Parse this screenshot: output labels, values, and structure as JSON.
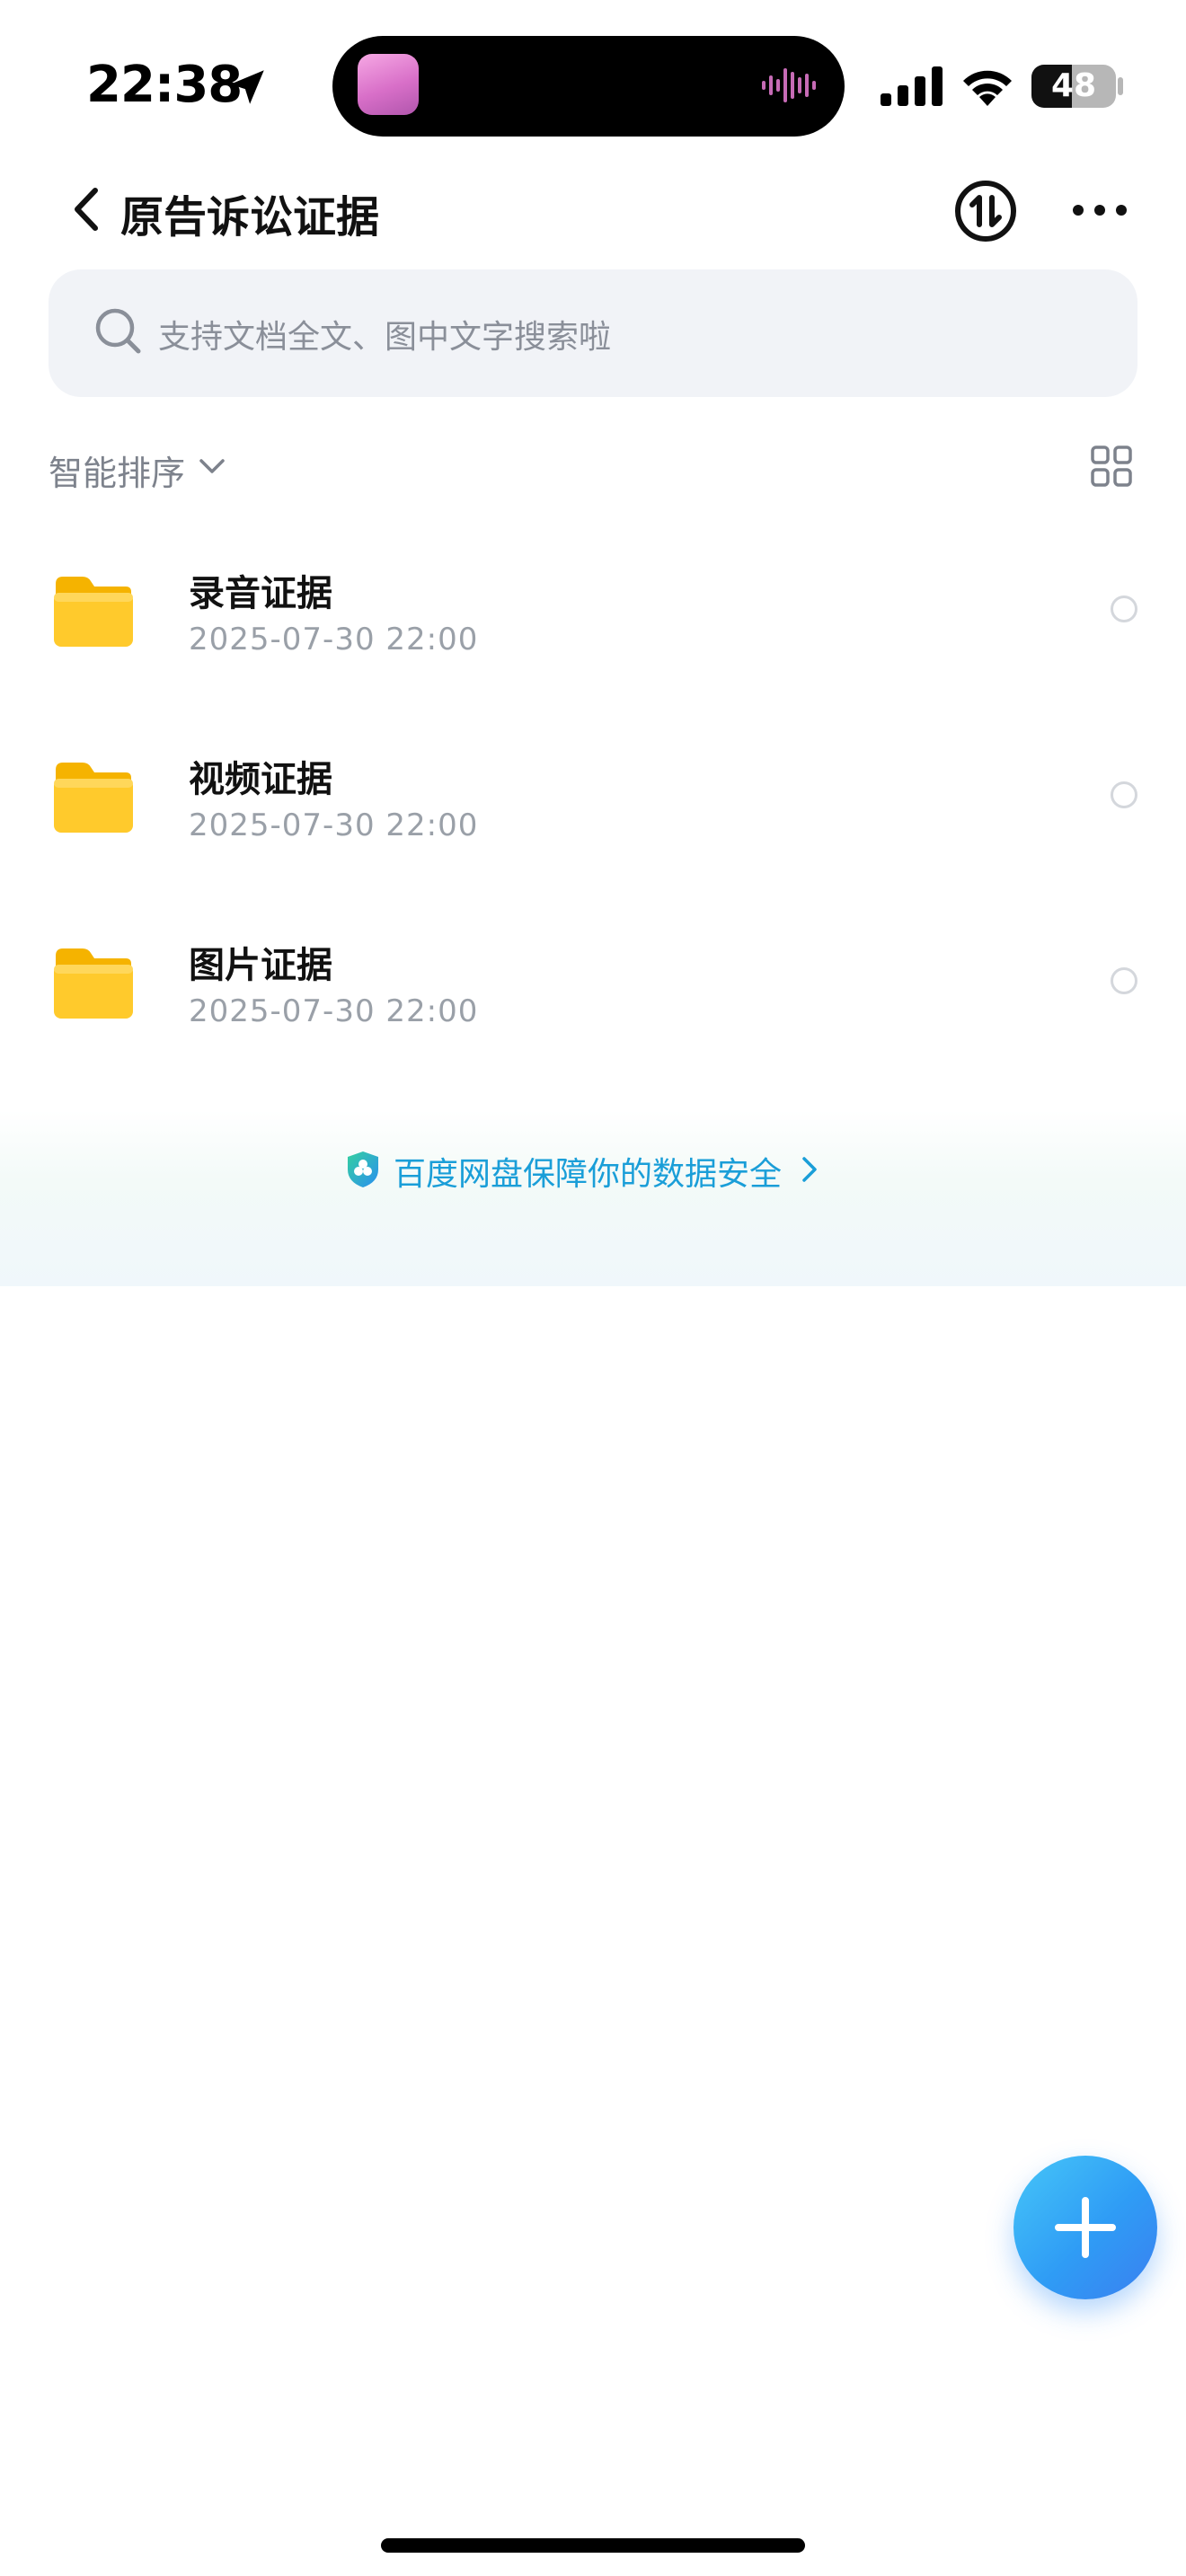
{
  "status_bar": {
    "time": "22:38",
    "battery_level": "48",
    "battery_fraction": 0.48
  },
  "nav": {
    "title": "原告诉讼证据"
  },
  "search": {
    "placeholder": "支持文档全文、图中文字搜索啦"
  },
  "sort": {
    "label": "智能排序"
  },
  "files": [
    {
      "name": "录音证据",
      "date": "2025-07-30 22:00",
      "type": "folder"
    },
    {
      "name": "视频证据",
      "date": "2025-07-30 22:00",
      "type": "folder"
    },
    {
      "name": "图片证据",
      "date": "2025-07-30 22:00",
      "type": "folder"
    }
  ],
  "security_banner": {
    "text": "百度网盘保障你的数据安全"
  },
  "icons": {
    "back": "chevron-left-icon",
    "transfer": "transfer-icon",
    "more": "more-dots-icon",
    "search": "search-icon",
    "sort_dropdown": "chevron-down-icon",
    "grid_view": "grid-view-icon",
    "folder": "folder-icon",
    "shield": "shield-icon",
    "add": "plus-icon"
  },
  "colors": {
    "accent": "#2f9cf5",
    "banner_text": "#1a9ed8",
    "folder": "#ffc928"
  }
}
